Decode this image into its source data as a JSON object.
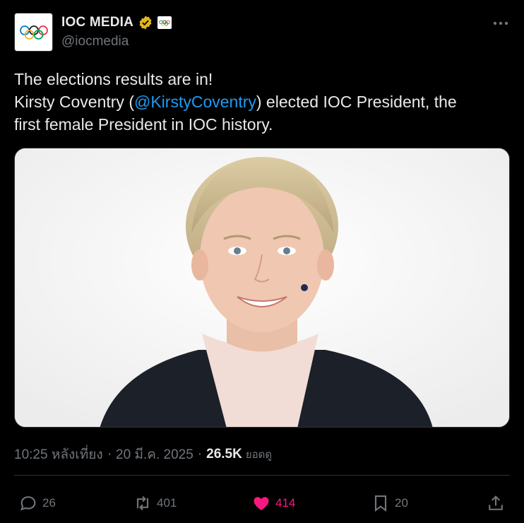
{
  "author": {
    "display_name": "IOC MEDIA",
    "handle": "@iocmedia",
    "verified_icon": "gold-verified-badge-icon",
    "affiliate_icon": "olympic-rings-icon"
  },
  "tweet": {
    "line1": "The elections results are in!",
    "line2_prefix": "Kirsty Coventry (",
    "mention": "@KirstyCoventry",
    "line2_suffix": ") elected IOC President, the",
    "line3": "first female President in IOC history."
  },
  "media": {
    "type": "photo",
    "icon": "portrait-photo-icon"
  },
  "meta": {
    "time": "10:25 หลังเที่ยง",
    "sep1": "·",
    "date": "20 มี.ค. 2025",
    "sep2": "·",
    "views_count": "26.5K",
    "views_label": "ยอดดู"
  },
  "actions": {
    "replies": "26",
    "reposts": "401",
    "likes": "414",
    "bookmarks": "20"
  },
  "colors": {
    "background": "#000000",
    "text": "#e7e9ea",
    "muted": "#71767b",
    "link": "#1d9bf0",
    "like": "#f91880",
    "verified": "#e2b719"
  }
}
